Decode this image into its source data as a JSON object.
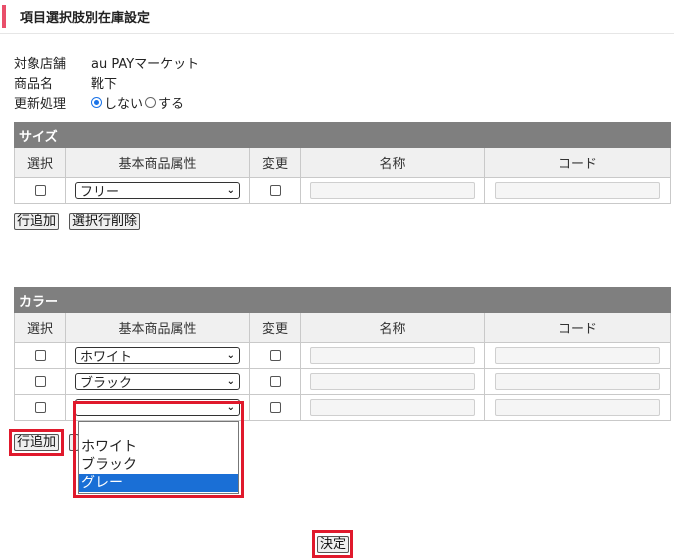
{
  "page": {
    "title": "項目選択肢別在庫設定"
  },
  "info": {
    "store": {
      "label": "対象店舗",
      "value": "au PAYマーケット"
    },
    "product": {
      "label": "商品名",
      "value": "靴下"
    },
    "update": {
      "label": "更新処理",
      "options": [
        "しない",
        "する"
      ],
      "selected": "しない"
    }
  },
  "columns": {
    "select": "選択",
    "attribute": "基本商品属性",
    "change": "変更",
    "name": "名称",
    "code": "コード"
  },
  "size_section": {
    "title": "サイズ",
    "rows": [
      {
        "attribute": "フリー"
      }
    ],
    "add_row_label": "行追加",
    "delete_rows_label": "選択行削除"
  },
  "color_section": {
    "title": "カラー",
    "rows": [
      {
        "attribute": "ホワイト"
      },
      {
        "attribute": "ブラック"
      },
      {
        "attribute": ""
      }
    ],
    "add_row_label": "行追加",
    "dropdown_options": [
      "ホワイト",
      "ブラック",
      "グレー"
    ],
    "dropdown_highlighted": "グレー"
  },
  "submit_label": "決定",
  "colors": {
    "accent": "#e94f6a",
    "highlight_box": "#e0192c",
    "section_header": "#7f7f7f",
    "selection": "#1a6fd6"
  }
}
